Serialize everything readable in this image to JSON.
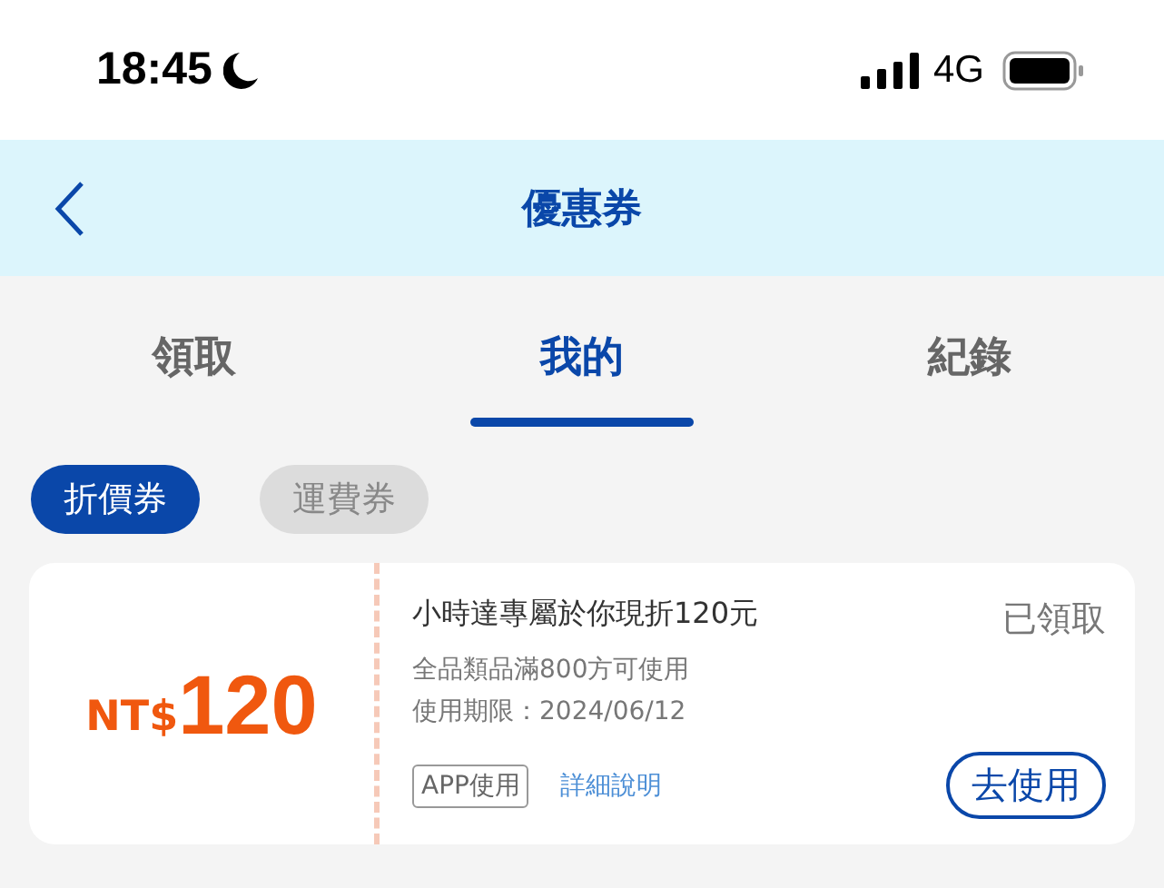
{
  "status_bar": {
    "time": "18:45",
    "network": "4G"
  },
  "header": {
    "title": "優惠券"
  },
  "tabs": [
    {
      "label": "領取",
      "selected": false
    },
    {
      "label": "我的",
      "selected": true
    },
    {
      "label": "紀錄",
      "selected": false
    }
  ],
  "filters": [
    {
      "label": "折價券",
      "selected": true
    },
    {
      "label": "運費券",
      "selected": false
    }
  ],
  "coupons": [
    {
      "currency": "NT$",
      "amount": "120",
      "title": "小時達專屬於你現折120元",
      "condition": "全品類品滿800方可使用",
      "expiry": "使用期限：2024/06/12",
      "status": "已領取",
      "tag": "APP使用",
      "details_link": "詳細說明",
      "action": "去使用"
    }
  ]
}
